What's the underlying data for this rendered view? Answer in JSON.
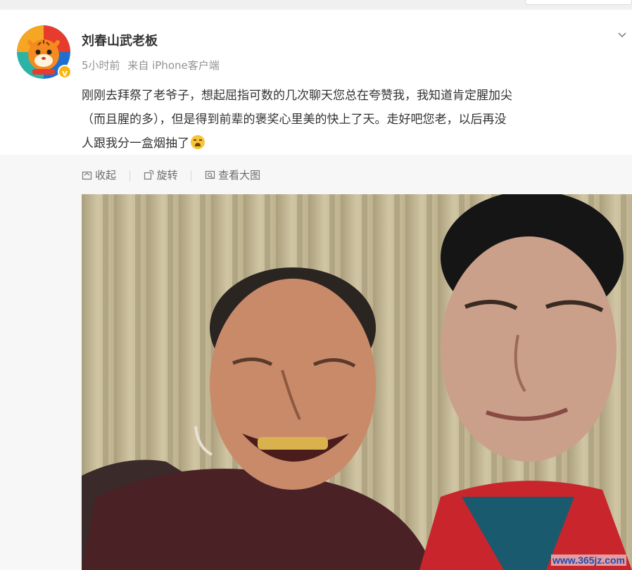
{
  "post": {
    "author": "刘春山武老板",
    "time": "5小时前",
    "source": "来自 iPhone客户端",
    "text_lines": [
      "刚刚去拜祭了老爷子，想起屈指可数的几次聊天您总在夸赞我，我知道肯定腥加尖",
      "（而且腥的多），但是得到前辈的褒奖心里美的快上了天。走好吧您老，以后再没",
      "人跟我分一盒烟抽了"
    ],
    "emoji": "crying-face-emoji"
  },
  "toolbar": {
    "collapse": "收起",
    "rotate": "旋转",
    "view_large": "查看大图"
  },
  "watermark": "www.365jz.com",
  "colors": {
    "text": "#333333",
    "meta": "#939393",
    "verified_badge": "#f9b40f",
    "watermark": "#1a4db5"
  }
}
